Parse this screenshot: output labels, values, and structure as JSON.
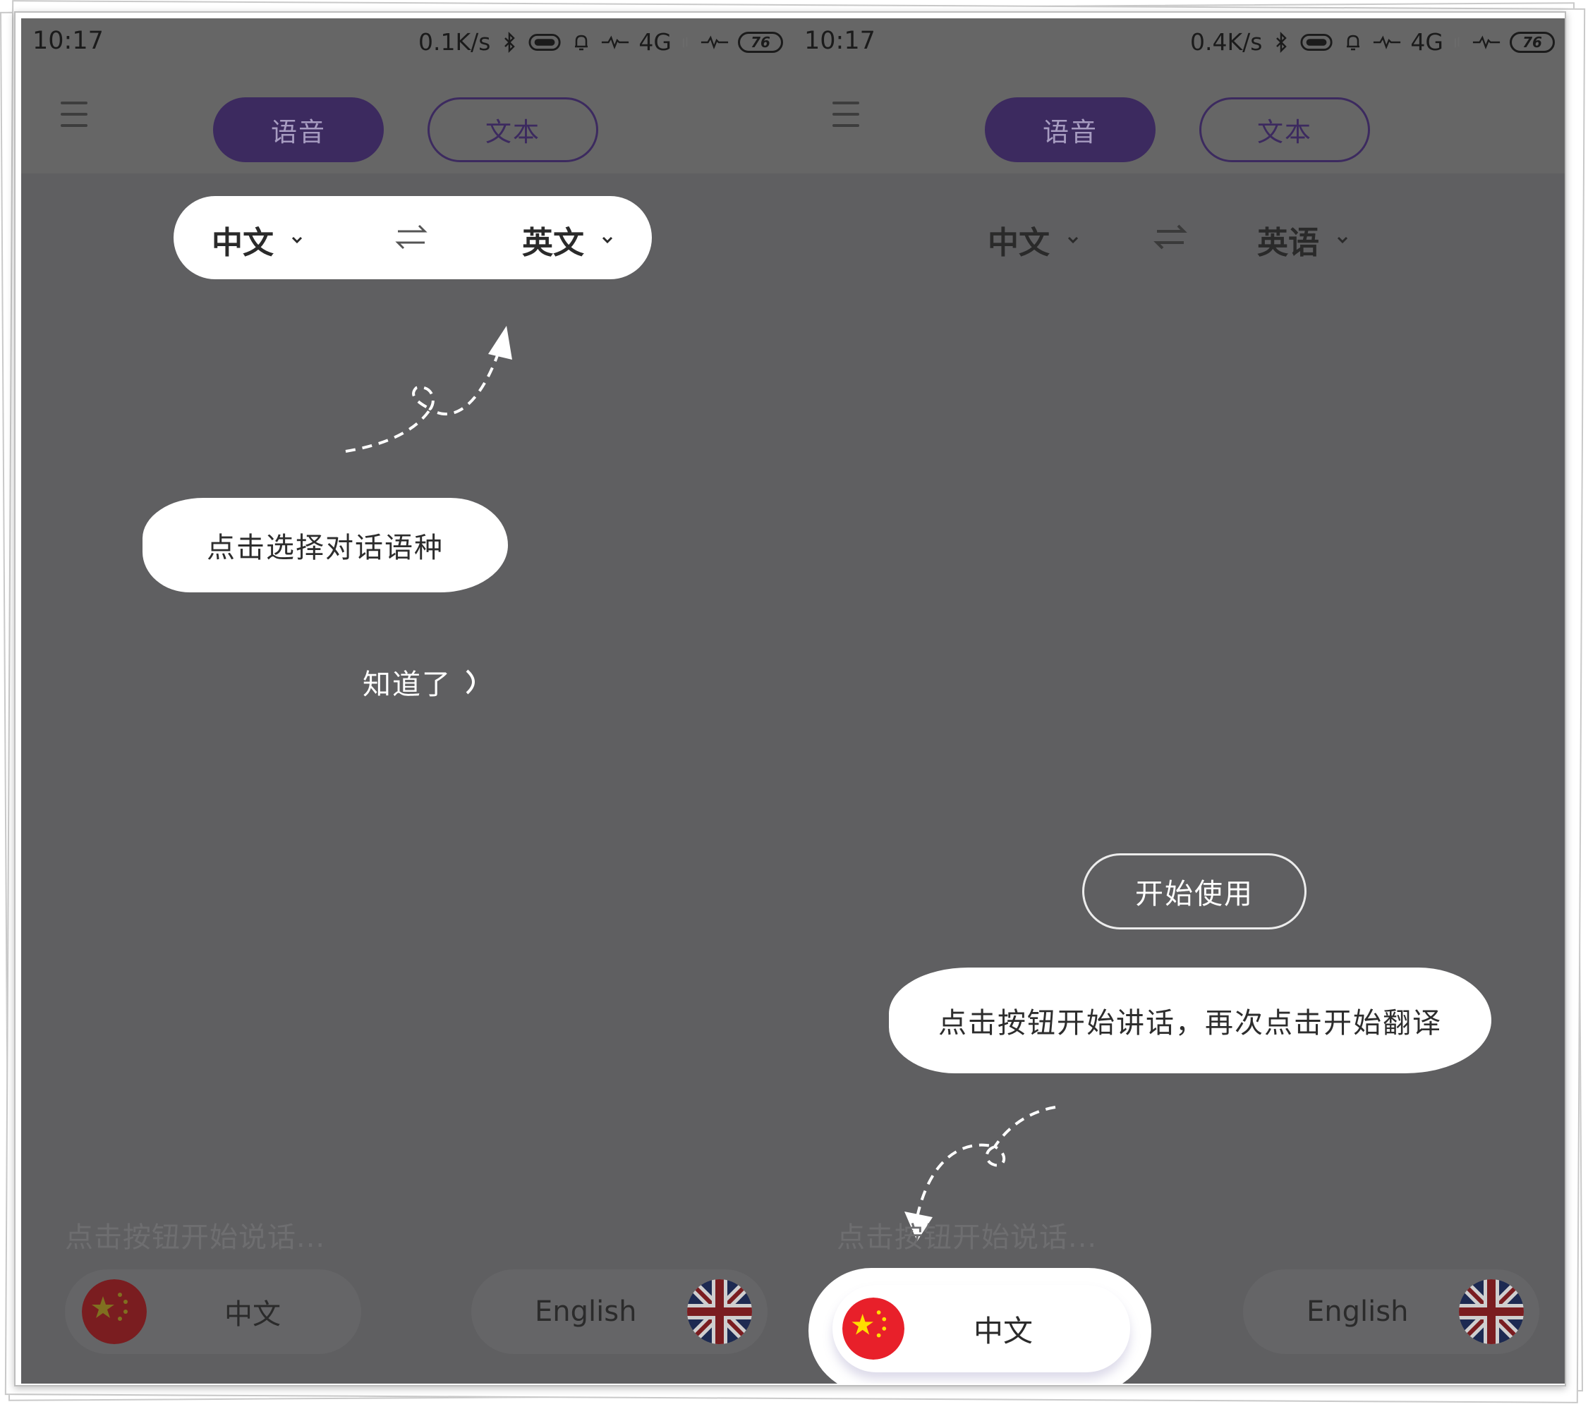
{
  "left_screen": {
    "status": {
      "time": "10:17",
      "speed": "0.1K/s",
      "network": "4G",
      "battery": "76"
    },
    "tabs": {
      "voice": "语音",
      "text": "文本"
    },
    "language_bar": {
      "source": "中文",
      "target": "英文"
    },
    "tooltip": "点击选择对话语种",
    "got_it": "知道了",
    "input_hint": "点击按钮开始说话...",
    "speakers": {
      "chinese": "中文",
      "english": "English"
    }
  },
  "right_screen": {
    "status": {
      "time": "10:17",
      "speed": "0.4K/s",
      "network": "4G",
      "battery": "76"
    },
    "tabs": {
      "voice": "语音",
      "text": "文本"
    },
    "language_bar": {
      "source": "中文",
      "target": "英语"
    },
    "start_button": "开始使用",
    "tooltip": "点击按钮开始讲话，再次点击开始翻译",
    "input_hint": "点击按钮开始说话...",
    "speakers": {
      "chinese": "中文",
      "english": "English"
    }
  },
  "colors": {
    "overlay": "#5f5f61",
    "accent": "#3c2a5f",
    "flag_red": "#e8202a",
    "flag_yellow": "#ffde00",
    "uk_blue": "#1f3a82"
  },
  "icons": [
    "menu-icon",
    "bluetooth-icon",
    "battery-icon",
    "bell-icon",
    "signal-icon",
    "swap-icon",
    "chevron-down-icon",
    "china-flag-icon",
    "uk-flag-icon",
    "arrow-icon"
  ]
}
